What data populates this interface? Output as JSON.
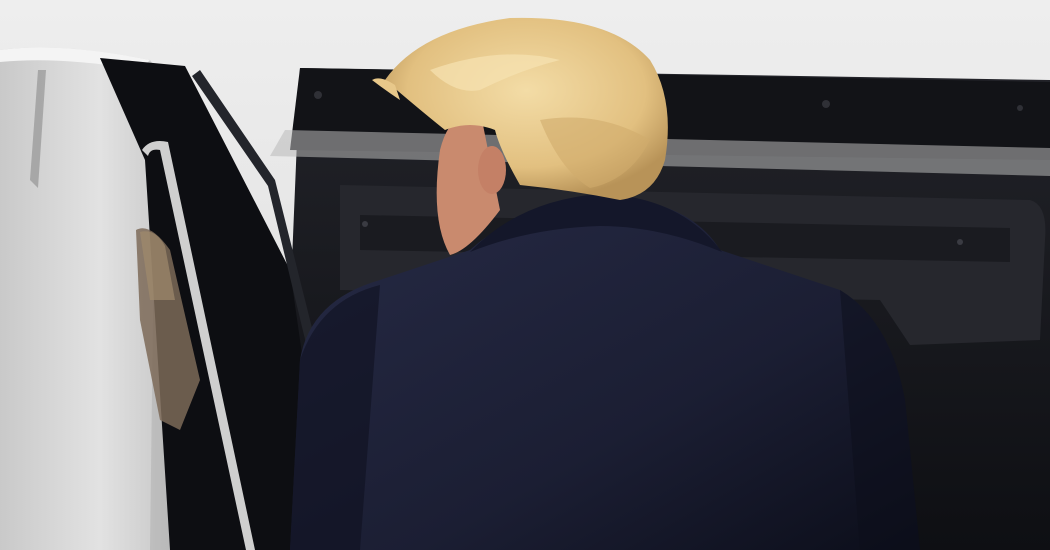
{
  "photo": {
    "palette": {
      "background_wall": "#e9e9e9",
      "car_body": "#d7d7d7",
      "car_shadow": "#a9a9a9",
      "car_interior": "#17181c",
      "car_interior_panel": "#2a2b30",
      "door_frame": "#0d0e12",
      "chrome_trim": "#c9c9c9",
      "coat": "#1d2035",
      "coat_shadow": "#0f1120",
      "hair": "#e8c88a",
      "hair_shadow": "#b89358",
      "skin": "#c98a6e",
      "reflection": "#8b7a68"
    }
  }
}
